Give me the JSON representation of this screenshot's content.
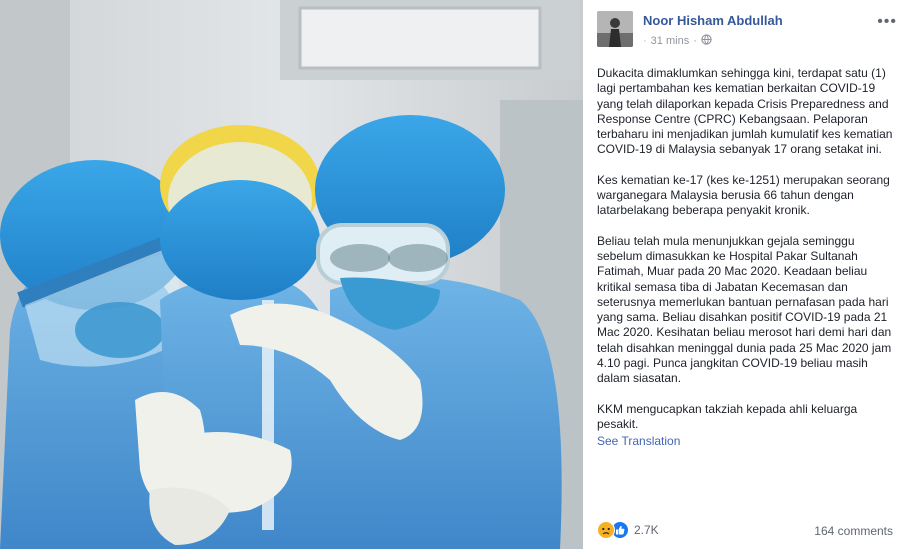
{
  "post": {
    "author": "Noor Hisham Abdullah",
    "timestamp": "31 mins",
    "separator": "·",
    "privacy_icon": "globe-icon",
    "more_icon": "more-options-icon",
    "paragraphs": [
      "Dukacita dimaklumkan sehingga kini, terdapat satu (1) lagi pertambahan kes kematian berkaitan COVID-19 yang telah dilaporkan kepada Crisis Preparedness and Response Centre (CPRC) Kebangsaan. Pelaporan terbaharu ini menjadikan jumlah kumulatif kes kematian COVID-19 di Malaysia sebanyak 17 orang setakat ini.",
      "Kes kematian ke-17 (kes ke-1251) merupakan seorang warganegara Malaysia berusia 66 tahun dengan latarbelakang beberapa penyakit kronik.",
      "Beliau telah mula menunjukkan gejala seminggu sebelum dimasukkan ke Hospital Pakar Sultanah Fatimah, Muar pada 20 Mac 2020. Keadaan beliau kritikal semasa tiba di Jabatan Kecemasan dan seterusnya memerlukan bantuan pernafasan pada hari yang sama. Beliau disahkan positif COVID-19 pada 21 Mac 2020. Kesihatan beliau merosot hari demi hari dan telah disahkan meninggal dunia pada 25 Mac 2020 jam 4.10 pagi. Punca jangkitan COVID-19 beliau masih dalam siasatan.",
      "KKM mengucapkan takziah kepada ahli keluarga pesakit."
    ],
    "see_translation": "See Translation",
    "reactions": {
      "icons": [
        "sad-reaction-icon",
        "like-reaction-icon"
      ],
      "count": "2.7K"
    },
    "comments": "164 comments",
    "colors": {
      "author": "#365899",
      "link": "#4267b2",
      "like": "#1877f2",
      "sad": "#f7b125"
    }
  }
}
